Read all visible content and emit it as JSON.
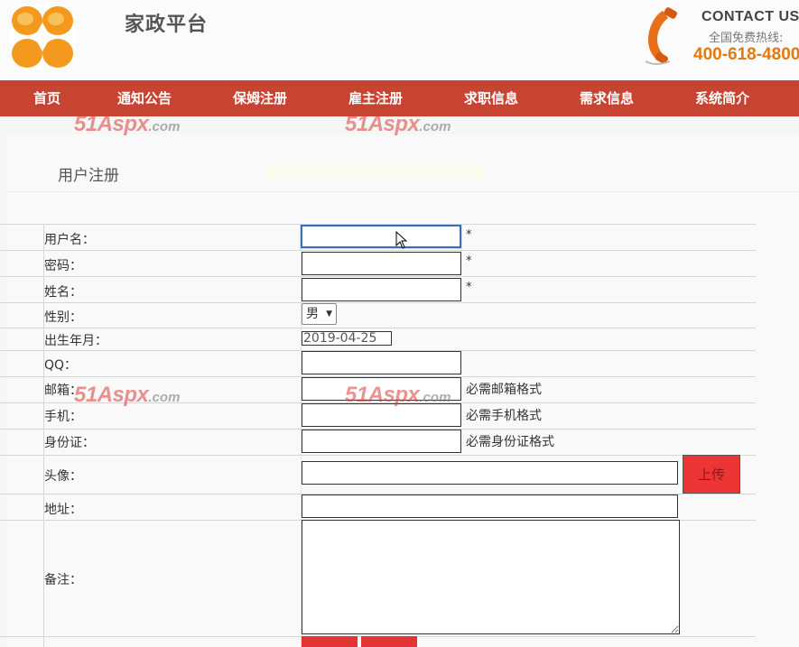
{
  "header": {
    "site_title": "家政平台",
    "contact_title": "CONTACT US",
    "hotline_label": "全国免费热线:",
    "hotline_number": "400-618-4800"
  },
  "nav": {
    "items": [
      "首页",
      "通知公告",
      "保姆注册",
      "雇主注册",
      "求职信息",
      "需求信息",
      "系统简介"
    ]
  },
  "watermark": {
    "main": "51Aspx",
    "suffix": ".com"
  },
  "page_title": "用户注册",
  "form": {
    "username_label": "用户名：",
    "password_label": "密码：",
    "realname_label": "姓名：",
    "gender_label": "性别：",
    "gender_value": "男",
    "birth_label": "出生年月：",
    "birth_value": "2019-04-25",
    "qq_label": "QQ：",
    "email_label": "邮箱：",
    "email_hint": "必需邮箱格式",
    "mobile_label": "手机：",
    "mobile_hint": "必需手机格式",
    "idcard_label": "身份证：",
    "idcard_hint": "必需身份证格式",
    "avatar_label": "头像：",
    "upload_label": "上传",
    "address_label": "地址：",
    "memo_label": "备注：",
    "required_mark": "*"
  },
  "colors": {
    "nav_bg": "#c74433",
    "accent_orange": "#e07a12",
    "button_red": "#ed3535"
  }
}
